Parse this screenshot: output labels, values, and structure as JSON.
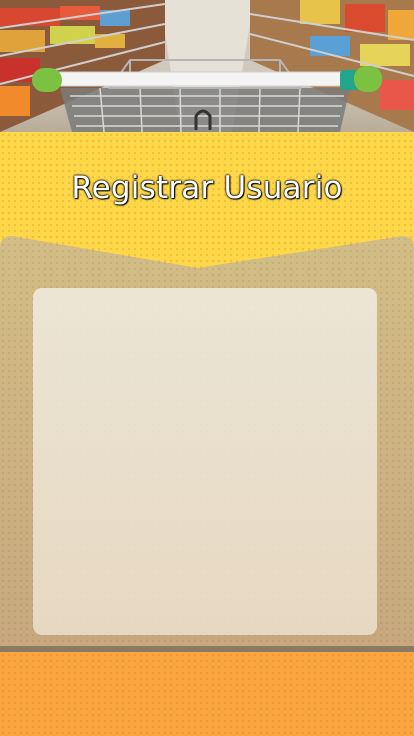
{
  "header": {
    "image": "supermarket-cart-image",
    "title": "Registrar Usuario"
  },
  "colors": {
    "panel": "#ffd84a",
    "card": "#c8ad82",
    "footer": "#f9a640",
    "title_text": "#ffffff"
  }
}
